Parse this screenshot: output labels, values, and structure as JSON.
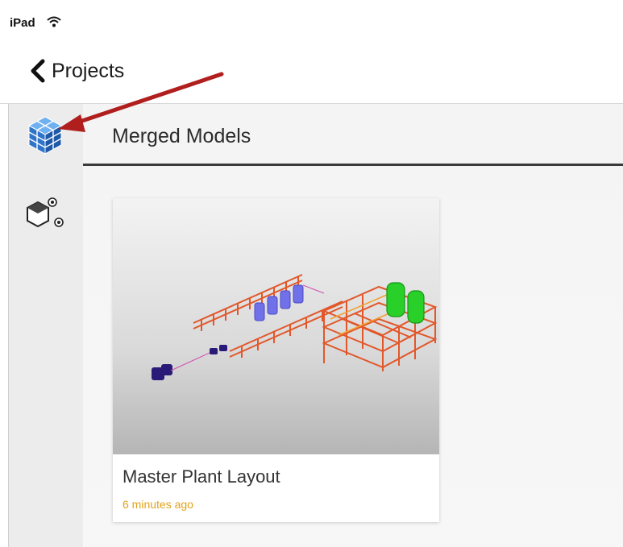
{
  "status_bar": {
    "device": "iPad",
    "wifi_icon": "wifi-icon"
  },
  "nav": {
    "back_label": "Projects",
    "back_icon": "chevron-left-icon"
  },
  "sidebar": {
    "items": [
      {
        "icon": "merged-models-cube-icon",
        "selected": true
      },
      {
        "icon": "models-icon",
        "selected": false
      }
    ]
  },
  "main": {
    "section_title": "Merged Models",
    "cards": [
      {
        "title": "Master Plant Layout",
        "time": "6 minutes ago"
      }
    ]
  },
  "colors": {
    "accent_time": "#e3a21a",
    "annotation_arrow": "#b01e1e",
    "cube_blue": "#3a7fd0"
  }
}
